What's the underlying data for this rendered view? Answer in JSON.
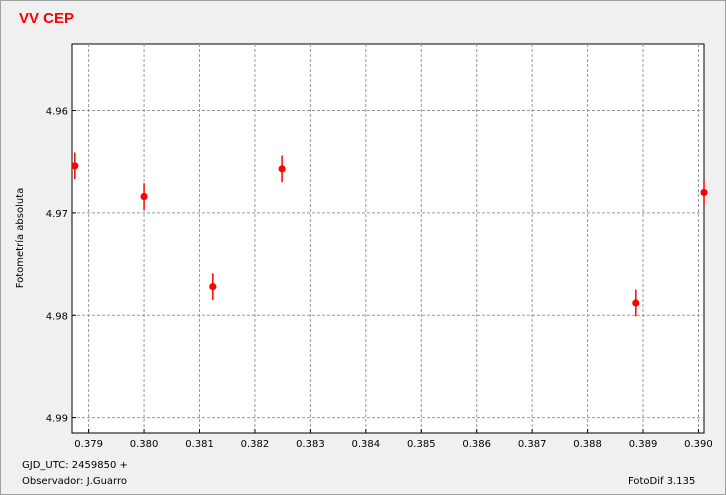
{
  "title": "VV CEP",
  "footer": {
    "gjd": "GJD_UTC: 2459850 +",
    "observer": "Observador: J.Guarro",
    "software": "FotoDif 3.135"
  },
  "colors": {
    "title": "#ff0000",
    "points": "#ff0000",
    "grid": "#999999"
  },
  "chart_data": {
    "type": "scatter",
    "title": "VV CEP",
    "ylabel": "Fotometría absoluta",
    "xlabel": "",
    "xlim": [
      0.3787,
      0.3901
    ],
    "ylim": [
      4.9535,
      4.9915
    ],
    "y_inverted": true,
    "grid": true,
    "x_ticks": [
      "0.379",
      "0.380",
      "0.381",
      "0.382",
      "0.383",
      "0.384",
      "0.385",
      "0.386",
      "0.387",
      "0.388",
      "0.389",
      "0.390"
    ],
    "y_ticks": [
      "4.96",
      "4.97",
      "4.98",
      "4.99"
    ],
    "points": [
      {
        "x": 0.37875,
        "y": 4.9654,
        "err": 0.0013
      },
      {
        "x": 0.38,
        "y": 4.9684,
        "err": 0.0013
      },
      {
        "x": 0.38124,
        "y": 4.9772,
        "err": 0.0013
      },
      {
        "x": 0.38249,
        "y": 4.9657,
        "err": 0.0013
      },
      {
        "x": 0.38887,
        "y": 4.9788,
        "err": 0.0013
      },
      {
        "x": 0.3901,
        "y": 4.968,
        "err": 0.0013
      }
    ]
  }
}
